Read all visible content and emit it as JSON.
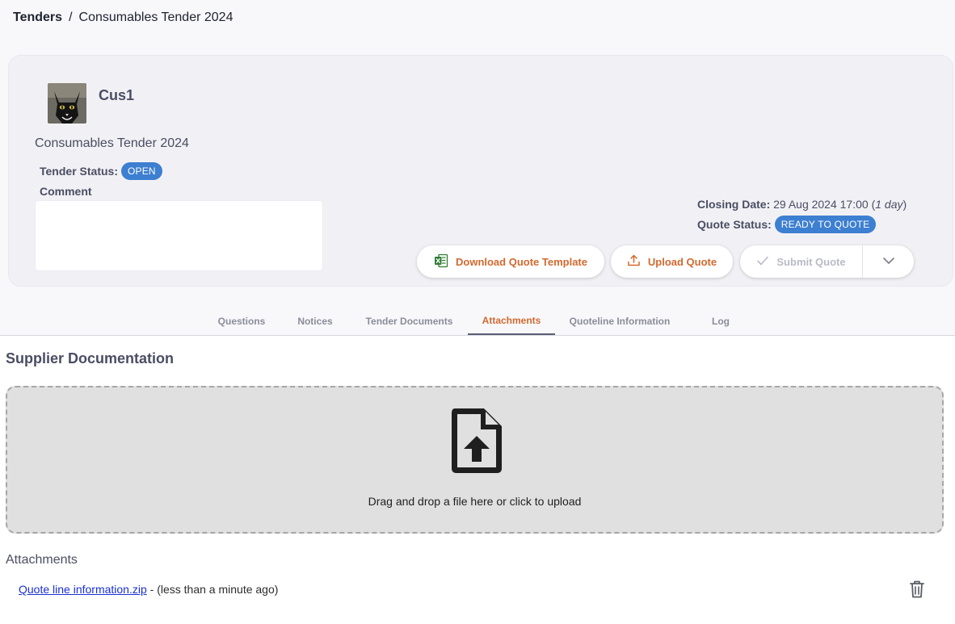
{
  "breadcrumb": {
    "root": "Tenders",
    "separator": "/",
    "current": "Consumables Tender 2024"
  },
  "customer": {
    "name": "Cus1",
    "avatar_icon": "cat-avatar"
  },
  "tender": {
    "title": "Consumables Tender 2024",
    "status_label": "Tender Status:",
    "status": "OPEN",
    "comment_label": "Comment",
    "comment_value": ""
  },
  "closing": {
    "label": "Closing Date:",
    "date": "29 Aug 2024 17:00",
    "paren_open": " (",
    "remaining": "1 day",
    "paren_close": ")"
  },
  "quote": {
    "status_label": "Quote Status:",
    "status": "READY TO QUOTE"
  },
  "actions": {
    "download": "Download Quote Template",
    "upload": "Upload Quote",
    "submit": "Submit Quote"
  },
  "tabs": [
    {
      "label": "Questions"
    },
    {
      "label": "Notices"
    },
    {
      "label": "Tender Documents"
    },
    {
      "label": "Attachments",
      "active": true
    },
    {
      "label": "Quoteline Information"
    },
    {
      "label": "Log"
    }
  ],
  "supplier_docs": {
    "title": "Supplier Documentation",
    "dropzone_text": "Drag and drop a file here or click to upload"
  },
  "attachments": {
    "title": "Attachments",
    "items": [
      {
        "filename": "Quote line information.zip",
        "meta": " - (less than a minute ago)"
      }
    ]
  },
  "colors": {
    "accent": "#d2692e",
    "badge": "#3d7fd1",
    "excel": "#2e7d32"
  }
}
